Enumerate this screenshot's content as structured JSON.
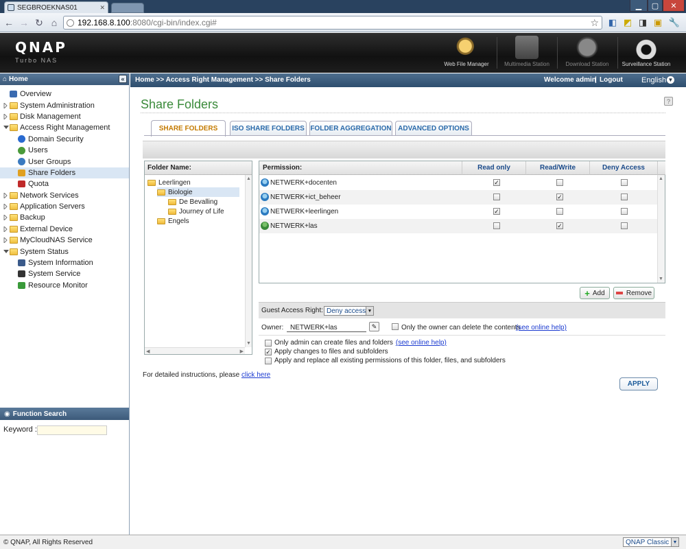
{
  "browser": {
    "tab_title": "SEGBROEKNAS01",
    "url_host": "192.168.8.100",
    "url_rest": ":8080/cgi-bin/index.cgi#"
  },
  "header": {
    "logo": "QNAP",
    "logo_sub": "Turbo NAS",
    "stations": [
      {
        "label": "Web File Manager",
        "icon": "web-file-manager-icon"
      },
      {
        "label": "Multimedia Station",
        "icon": "multimedia-station-icon"
      },
      {
        "label": "Download Station",
        "icon": "download-station-icon"
      },
      {
        "label": "Surveillance Station",
        "icon": "surveillance-station-icon"
      }
    ]
  },
  "sidebar": {
    "title": "Home",
    "items": [
      {
        "label": "Overview",
        "icon": "overview-icon"
      },
      {
        "label": "System Administration",
        "icon": "folder-icon"
      },
      {
        "label": "Disk Management",
        "icon": "folder-icon"
      },
      {
        "label": "Access Right Management",
        "icon": "folder-open-icon"
      },
      {
        "label": "Domain Security",
        "icon": "domain-security-icon"
      },
      {
        "label": "Users",
        "icon": "user-icon"
      },
      {
        "label": "User Groups",
        "icon": "user-groups-icon"
      },
      {
        "label": "Share Folders",
        "icon": "share-folders-icon"
      },
      {
        "label": "Quota",
        "icon": "quota-icon"
      },
      {
        "label": "Network Services",
        "icon": "folder-icon"
      },
      {
        "label": "Application Servers",
        "icon": "folder-icon"
      },
      {
        "label": "Backup",
        "icon": "folder-icon"
      },
      {
        "label": "External Device",
        "icon": "folder-icon"
      },
      {
        "label": "MyCloudNAS Service",
        "icon": "folder-icon"
      },
      {
        "label": "System Status",
        "icon": "folder-open-icon"
      },
      {
        "label": "System Information",
        "icon": "system-information-icon"
      },
      {
        "label": "System Service",
        "icon": "system-service-icon"
      },
      {
        "label": "Resource Monitor",
        "icon": "resource-monitor-icon"
      }
    ],
    "function_search": "Function Search",
    "keyword_label": "Keyword :"
  },
  "topbar": {
    "breadcrumb": "Home >> Access Right Management >> Share Folders",
    "welcome": "Welcome admin",
    "divider": "|",
    "logout": "Logout",
    "language": "English"
  },
  "page": {
    "title": "Share Folders",
    "help": "?",
    "tabs": [
      "SHARE FOLDERS",
      "ISO SHARE FOLDERS",
      "FOLDER AGGREGATION",
      "ADVANCED OPTIONS"
    ]
  },
  "folders": {
    "header": "Folder Name:",
    "nodes": [
      "Leerlingen",
      "Biologie",
      "De Bevalling",
      "Journey of Life",
      "Engels"
    ]
  },
  "permissions": {
    "headers": [
      "Permission:",
      "Read only",
      "Read/Write",
      "Deny Access"
    ],
    "rows": [
      {
        "name": "NETWERK+docenten",
        "read_only": true,
        "read_write": false,
        "deny": false,
        "type": "group"
      },
      {
        "name": "NETWERK+ict_beheer",
        "read_only": false,
        "read_write": true,
        "deny": false,
        "type": "group"
      },
      {
        "name": "NETWERK+leerlingen",
        "read_only": true,
        "read_write": false,
        "deny": false,
        "type": "group"
      },
      {
        "name": "NETWERK+las",
        "read_only": false,
        "read_write": true,
        "deny": false,
        "type": "user"
      }
    ],
    "add": "Add",
    "remove": "Remove"
  },
  "guest": {
    "label": "Guest Access Right:",
    "value": "Deny access"
  },
  "owner": {
    "label": "Owner:",
    "value": "NETWERK+las",
    "only_owner_delete": "Only the owner can delete the contents",
    "help_link": "(see online help)"
  },
  "options": [
    {
      "label": "Only admin can create files and folders",
      "checked": false,
      "link": "(see online help)"
    },
    {
      "label": "Apply changes to files and subfolders",
      "checked": true,
      "link": ""
    },
    {
      "label": "Apply and replace all existing permissions of this folder, files, and subfolders",
      "checked": false,
      "link": ""
    }
  ],
  "instructions": {
    "text": "For detailed instructions, please",
    "link": "click here"
  },
  "apply": "APPLY",
  "footer": {
    "copyright": "© QNAP, All Rights Reserved",
    "theme": "QNAP Classic"
  }
}
